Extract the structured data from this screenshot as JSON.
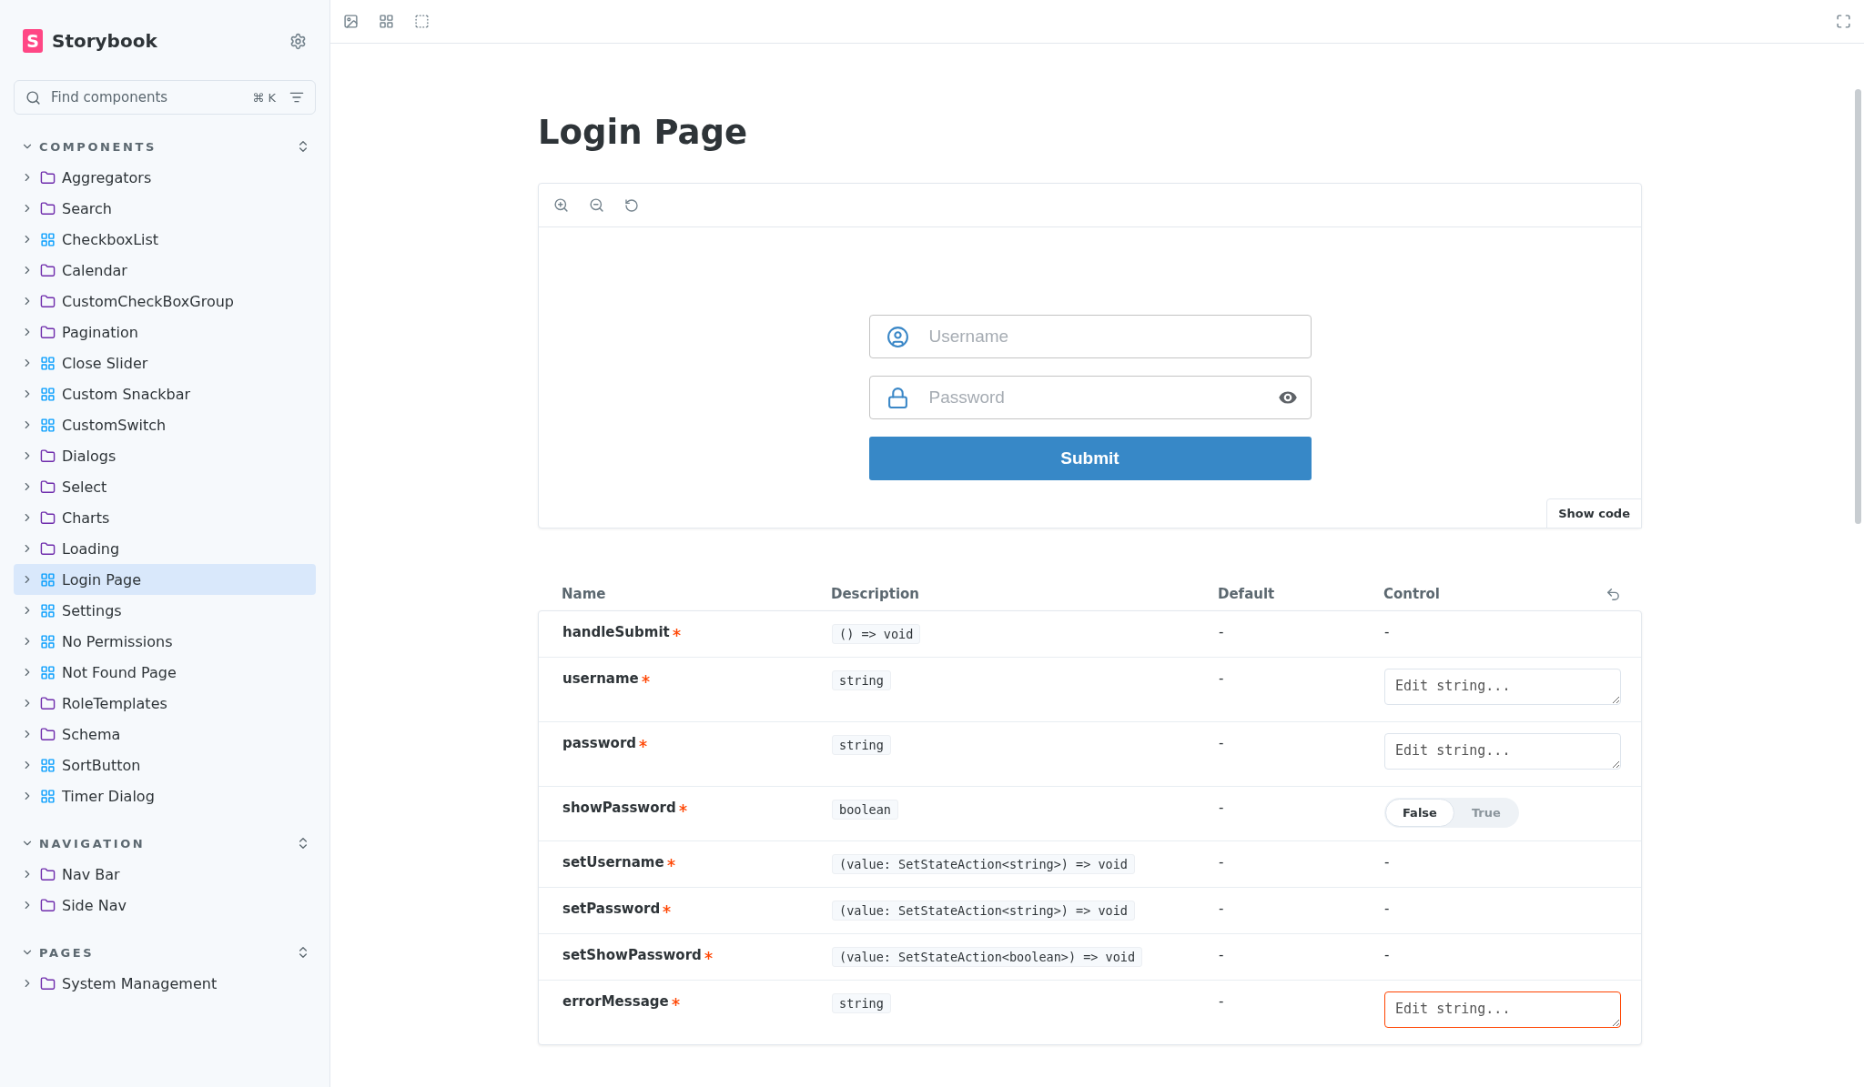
{
  "sidebar": {
    "logo_mark": "S",
    "brand": "Storybook",
    "search": {
      "placeholder": "Find components",
      "shortcut": "⌘ K"
    },
    "sections": [
      {
        "title": "COMPONENTS",
        "expanded": true,
        "items": [
          {
            "label": "Aggregators",
            "kind": "folder",
            "selected": false
          },
          {
            "label": "Search",
            "kind": "folder",
            "selected": false
          },
          {
            "label": "CheckboxList",
            "kind": "component",
            "selected": false
          },
          {
            "label": "Calendar",
            "kind": "folder",
            "selected": false
          },
          {
            "label": "CustomCheckBoxGroup",
            "kind": "folder",
            "selected": false
          },
          {
            "label": "Pagination",
            "kind": "folder",
            "selected": false
          },
          {
            "label": "Close Slider",
            "kind": "component",
            "selected": false
          },
          {
            "label": "Custom Snackbar",
            "kind": "component",
            "selected": false
          },
          {
            "label": "CustomSwitch",
            "kind": "component",
            "selected": false
          },
          {
            "label": "Dialogs",
            "kind": "folder",
            "selected": false
          },
          {
            "label": "Select",
            "kind": "folder",
            "selected": false
          },
          {
            "label": "Charts",
            "kind": "folder",
            "selected": false
          },
          {
            "label": "Loading",
            "kind": "folder",
            "selected": false
          },
          {
            "label": "Login Page",
            "kind": "component",
            "selected": true
          },
          {
            "label": "Settings",
            "kind": "component",
            "selected": false
          },
          {
            "label": "No Permissions",
            "kind": "component",
            "selected": false
          },
          {
            "label": "Not Found Page",
            "kind": "component",
            "selected": false
          },
          {
            "label": "RoleTemplates",
            "kind": "folder",
            "selected": false
          },
          {
            "label": "Schema",
            "kind": "folder",
            "selected": false
          },
          {
            "label": "SortButton",
            "kind": "component",
            "selected": false
          },
          {
            "label": "Timer Dialog",
            "kind": "component",
            "selected": false
          }
        ]
      },
      {
        "title": "NAVIGATION",
        "expanded": true,
        "items": [
          {
            "label": "Nav Bar",
            "kind": "folder",
            "selected": false
          },
          {
            "label": "Side Nav",
            "kind": "folder",
            "selected": false
          }
        ]
      },
      {
        "title": "PAGES",
        "expanded": true,
        "items": [
          {
            "label": "System Management",
            "kind": "folder",
            "selected": false
          }
        ]
      }
    ]
  },
  "page": {
    "title": "Login Page",
    "preview": {
      "username": {
        "placeholder": "Username"
      },
      "password": {
        "placeholder": "Password"
      },
      "submit": "Submit",
      "show_code": "Show code"
    },
    "props_table": {
      "columns": [
        "Name",
        "Description",
        "Default",
        "Control"
      ],
      "rows": [
        {
          "name": "handleSubmit",
          "required": true,
          "type": "() => void",
          "default": "-",
          "control": {
            "kind": "none",
            "text": "-"
          }
        },
        {
          "name": "username",
          "required": true,
          "type": "string",
          "default": "-",
          "control": {
            "kind": "text",
            "placeholder": "Edit string...",
            "error": false
          }
        },
        {
          "name": "password",
          "required": true,
          "type": "string",
          "default": "-",
          "control": {
            "kind": "text",
            "placeholder": "Edit string...",
            "error": false
          }
        },
        {
          "name": "showPassword",
          "required": true,
          "type": "boolean",
          "default": "-",
          "control": {
            "kind": "boolean",
            "options": [
              {
                "label": "False",
                "selected": true
              },
              {
                "label": "True",
                "selected": false
              }
            ]
          }
        },
        {
          "name": "setUsername",
          "required": true,
          "type": "(value: SetStateAction<string>) => void",
          "default": "-",
          "control": {
            "kind": "none",
            "text": "-"
          }
        },
        {
          "name": "setPassword",
          "required": true,
          "type": "(value: SetStateAction<string>) => void",
          "default": "-",
          "control": {
            "kind": "none",
            "text": "-"
          }
        },
        {
          "name": "setShowPassword",
          "required": true,
          "type": "(value: SetStateAction<boolean>) => void",
          "default": "-",
          "control": {
            "kind": "none",
            "text": "-"
          }
        },
        {
          "name": "errorMessage",
          "required": true,
          "type": "string",
          "default": "-",
          "control": {
            "kind": "text",
            "placeholder": "Edit string...",
            "error": true
          }
        }
      ]
    }
  }
}
